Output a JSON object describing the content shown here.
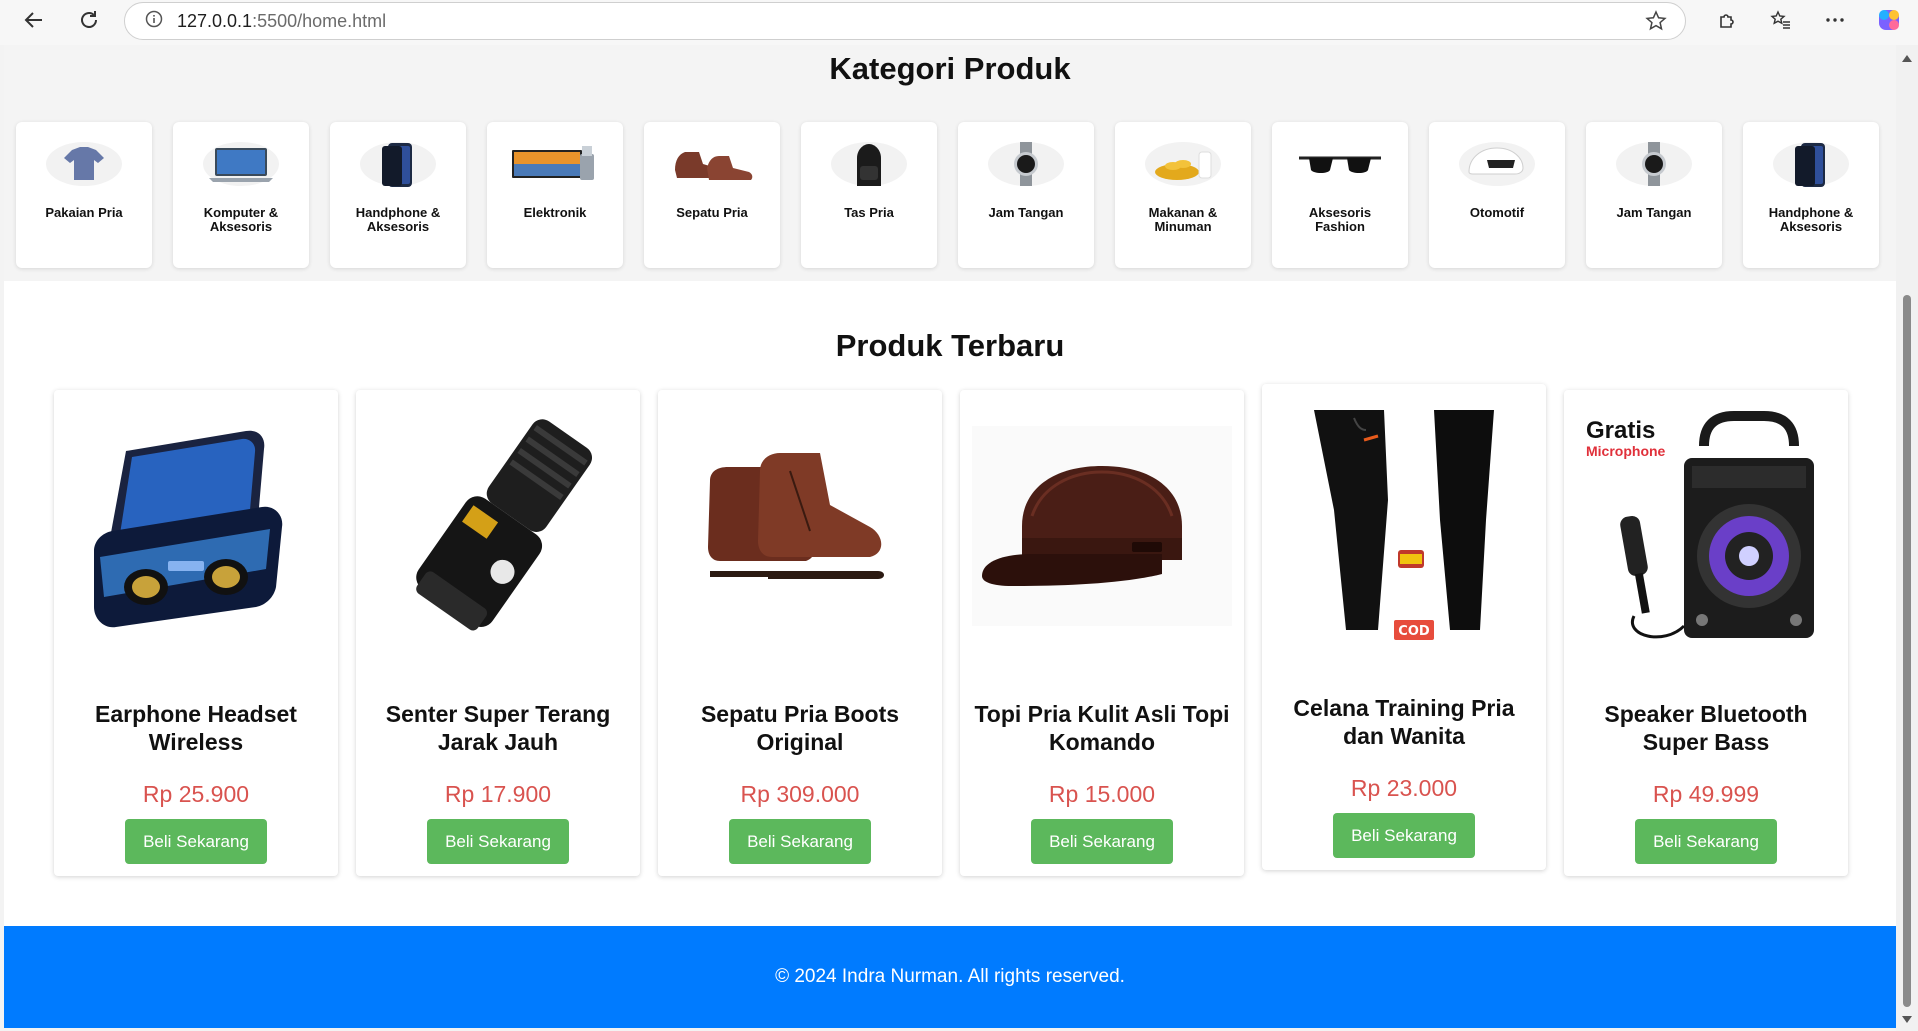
{
  "browser": {
    "url_host": "127.0.0.1",
    "url_path": ":5500/home.html"
  },
  "categories": {
    "title": "Kategori Produk",
    "items": [
      {
        "label": "Pakaian Pria",
        "icon": "shirt-icon"
      },
      {
        "label": "Komputer & Aksesoris",
        "icon": "laptop-icon"
      },
      {
        "label": "Handphone & Aksesoris",
        "icon": "phone-icon"
      },
      {
        "label": "Elektronik",
        "icon": "tv-icon"
      },
      {
        "label": "Sepatu Pria",
        "icon": "shoe-icon"
      },
      {
        "label": "Tas Pria",
        "icon": "backpack-icon"
      },
      {
        "label": "Jam Tangan",
        "icon": "watch-icon"
      },
      {
        "label": "Makanan & Minuman",
        "icon": "food-icon"
      },
      {
        "label": "Aksesoris Fashion",
        "icon": "sunglasses-icon"
      },
      {
        "label": "Otomotif",
        "icon": "helmet-icon"
      },
      {
        "label": "Jam Tangan",
        "icon": "watch-icon"
      },
      {
        "label": "Handphone & Aksesoris",
        "icon": "phone-icon"
      }
    ]
  },
  "products": {
    "title": "Produk Terbaru",
    "items": [
      {
        "name": "Earphone Headset Wireless",
        "price": "Rp 25.900",
        "button": "Beli Sekarang",
        "image": "earphone-image"
      },
      {
        "name": "Senter Super Terang Jarak Jauh",
        "price": "Rp 17.900",
        "button": "Beli Sekarang",
        "image": "flashlight-image"
      },
      {
        "name": "Sepatu Pria Boots Original",
        "price": "Rp 309.000",
        "button": "Beli Sekarang",
        "image": "boots-image"
      },
      {
        "name": "Topi Pria Kulit Asli Topi Komando",
        "price": "Rp 15.000",
        "button": "Beli Sekarang",
        "image": "cap-image"
      },
      {
        "name": "Celana Training Pria dan Wanita",
        "price": "Rp 23.000",
        "button": "Beli Sekarang",
        "image": "pants-image"
      },
      {
        "name": "Speaker Bluetooth Super Bass",
        "price": "Rp 49.999",
        "button": "Beli Sekarang",
        "image": "speaker-image",
        "image_text": {
          "gratis": "Gratis",
          "microphone": "Microphone"
        }
      }
    ]
  },
  "footer": {
    "text": "© 2024 Indra Nurman. All rights reserved."
  },
  "colors": {
    "footer_bg": "#007bff",
    "price": "#d9534f",
    "button": "#5cb85c"
  }
}
